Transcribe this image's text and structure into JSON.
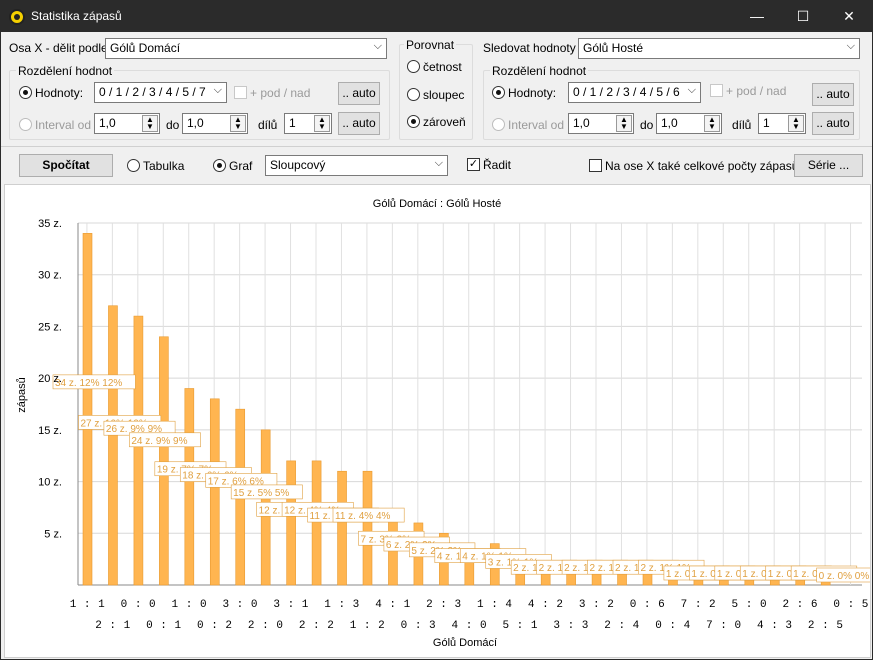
{
  "window": {
    "title": "Statistika zápasů",
    "minimize": "—",
    "maximize": "☐",
    "close": "✕"
  },
  "left": {
    "axis_label": "Osa X - dělit podle",
    "axis_value": "Gólů Domácí",
    "group_title": "Rozdělení hodnot",
    "values_label": "Hodnoty:",
    "values": "0 / 1 / 2 / 3 / 4 / 5 / 7",
    "podnad": "+ pod / nad",
    "auto": ".. auto",
    "interval_label": "Interval od",
    "from": "1,0",
    "to_label": "do",
    "to": "1,0",
    "parts_label": "dílů",
    "parts": "1",
    "auto2": ".. auto"
  },
  "compare": {
    "title": "Porovnat",
    "opt1": "četnost",
    "opt2": "sloupec",
    "opt3": "zároveň"
  },
  "right": {
    "axis_label": "Sledovat hodnoty",
    "axis_value": "Gólů Hosté",
    "group_title": "Rozdělení hodnot",
    "values_label": "Hodnoty:",
    "values": "0 / 1 / 2 / 3 / 4 / 5 / 6",
    "podnad": "+ pod / nad",
    "auto": ".. auto",
    "interval_label": "Interval od",
    "from": "1,0",
    "to_label": "do",
    "to": "1,0",
    "parts_label": "dílů",
    "parts": "1",
    "auto2": ".. auto"
  },
  "toolbar": {
    "compute": "Spočítat",
    "table": "Tabulka",
    "graph": "Graf",
    "graph_type": "Sloupcový",
    "sort": "Řadit",
    "totals": "Na ose X také celkové počty zápasů",
    "series": "Série ..."
  },
  "chart_data": {
    "type": "bar",
    "title": "Gólů Domácí : Gólů Hosté",
    "xlabel": "Gólů Domácí",
    "ylabel": "zápasů",
    "ylim": [
      0,
      35
    ],
    "yticks": [
      "5 z.",
      "10 z.",
      "15 z.",
      "20 z.",
      "25 z.",
      "30 z.",
      "35 z."
    ],
    "bar_color": "#ffb550",
    "label_color": "#e0a040",
    "categories": [
      "1 : 1",
      "2 : 1",
      "0 : 0",
      "0 : 1",
      "1 : 0",
      "0 : 2",
      "3 : 0",
      "2 : 0",
      "3 : 1",
      "2 : 2",
      "1 : 3",
      "1 : 2",
      "4 : 1",
      "0 : 3",
      "2 : 3",
      "4 : 0",
      "1 : 4",
      "5 : 1",
      "4 : 2",
      "3 : 3",
      "3 : 2",
      "2 : 4",
      "0 : 6",
      "0 : 4",
      "7 : 2",
      "7 : 0",
      "5 : 0",
      "4 : 3",
      "2 : 6",
      "2 : 5",
      "0 : 5"
    ],
    "values": [
      34,
      27,
      26,
      24,
      19,
      18,
      17,
      15,
      12,
      12,
      11,
      11,
      7,
      6,
      5,
      4,
      4,
      3,
      2,
      2,
      2,
      2,
      2,
      2,
      1,
      1,
      1,
      1,
      1,
      1,
      0
    ],
    "labels": [
      "34 z.  12% 12%",
      "27 z.  10% 10%",
      "26 z.  9% 9%",
      "24 z.  9% 9%",
      "19 z.  7% 7%",
      "18 z.  6% 6%",
      "17 z.  6% 6%",
      "15 z.  5% 5%",
      "12 z.  4% 4%",
      "12 z.  4% 4%",
      "11 z.  4% 4%",
      "11 z.  4% 4%",
      "7 z.  3% 3%",
      "6 z.  2% 2%",
      "5 z.  2% 2%",
      "4 z.  1% 1%",
      "4 z.  1% 1%",
      "3 z.  1% 1%",
      "2 z.  1% 1%",
      "2 z.  1% 1%",
      "2 z.  1% 1%",
      "2 z.  1% 1%",
      "2 z.  1% 1%",
      "2 z.  1% 1%",
      "1 z.  0% 0%",
      "1 z.  0% 0%",
      "1 z.  0% 0%",
      "1 z.  0% 0%",
      "1 z.  0% 0%",
      "1 z.  0% 0%",
      "0 z.  0% 0%"
    ]
  }
}
